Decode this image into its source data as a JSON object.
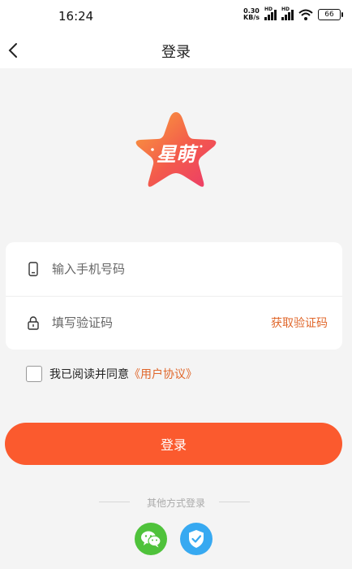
{
  "status_bar": {
    "time": "16:24",
    "net_speed_value": "0.30",
    "net_speed_unit": "KB/s",
    "signal1_label": "HD",
    "signal2_label": "HD",
    "battery": "66"
  },
  "header": {
    "title": "登录",
    "back_icon": "chevron-left-icon"
  },
  "logo": {
    "text": "星萌",
    "icon": "star-logo",
    "colors": [
      "#f9a23b",
      "#f35a4c",
      "#ec3a6b"
    ]
  },
  "form": {
    "phone_placeholder": "输入手机号码",
    "phone_icon": "phone-icon",
    "code_placeholder": "填写验证码",
    "code_icon": "lock-icon",
    "get_code_label": "获取验证码"
  },
  "agreement": {
    "text": "我已阅读并同意",
    "link": "《用户协议》",
    "checked": false
  },
  "login_button": {
    "label": "登录",
    "color": "#fb5a2e"
  },
  "other_login": {
    "label": "其他方式登录",
    "options": [
      {
        "icon": "wechat-icon",
        "color": "#4fc23b"
      },
      {
        "icon": "shield-check-icon",
        "color": "#37a9f1"
      }
    ]
  },
  "accent_color": "#e0672b"
}
